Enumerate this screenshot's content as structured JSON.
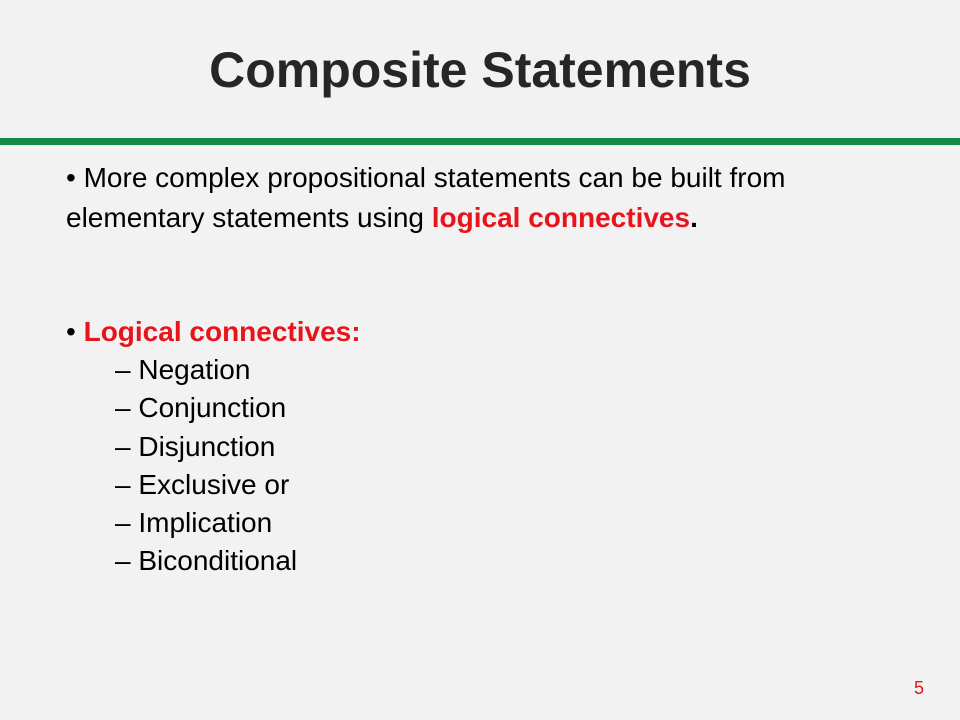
{
  "slide": {
    "title": "Composite Statements",
    "bullet_marker": "•",
    "bullet1": {
      "text_before": "More complex propositional statements can be built from elementary statements using ",
      "highlight": "logical connectives",
      "text_after": "."
    },
    "bullet2": {
      "label": "Logical connectives:"
    },
    "sub_marker": "–",
    "connectives": [
      "Negation",
      "Conjunction",
      "Disjunction",
      "Exclusive or",
      "Implication",
      "Biconditional"
    ],
    "page_number": "5"
  },
  "colors": {
    "background": "#f2f2f2",
    "title": "#262626",
    "rule": "#138a4a",
    "highlight": "#e8141b",
    "page_number": "#e8141b"
  }
}
